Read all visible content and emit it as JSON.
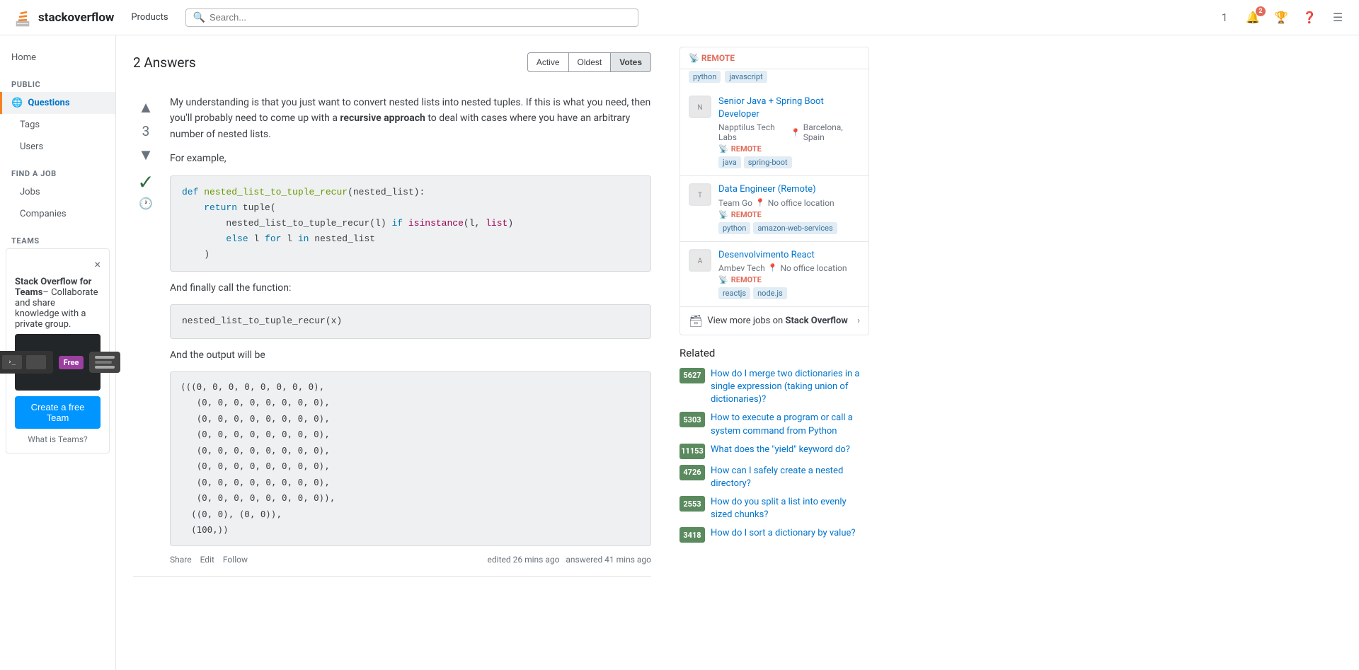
{
  "header": {
    "logo_text_part1": "stack",
    "logo_text_part2": "overflow",
    "nav_products": "Products",
    "search_placeholder": "Search...",
    "notif_count": "2",
    "inbox_count": "1"
  },
  "sidebar": {
    "home": "Home",
    "public_label": "PUBLIC",
    "questions": "Questions",
    "tags": "Tags",
    "users": "Users",
    "find_a_job": "FIND A JOB",
    "jobs": "Jobs",
    "companies": "Companies",
    "teams_label": "TEAMS"
  },
  "answers": {
    "title": "2 Answers",
    "sort_buttons": [
      "Active",
      "Oldest",
      "Votes"
    ],
    "active_sort": "Votes",
    "answer1": {
      "vote_count": "3",
      "accepted": true,
      "body_text": "My understanding is that you just want to convert nested lists into nested tuples. If this is what you need, then you'll probably need to come up with a ",
      "body_bold": "recursive approach",
      "body_text2": " to deal with cases where you have an arbitrary number of nested lists.",
      "example_label": "For example,",
      "code": "def nested_list_to_tuple_recur(nested_list):\n    return tuple(\n        nested_list_to_tuple_recur(l) if isinstance(l, list)\n        else l for l in nested_list\n    )",
      "finally_label": "And finally call the function:",
      "call_code": "nested_list_to_tuple_recur(x)",
      "output_label": "And the output will be",
      "output_code": "(((0, 0, 0, 0, 0, 0, 0, 0),\n   (0, 0, 0, 0, 0, 0, 0, 0),\n   (0, 0, 0, 0, 0, 0, 0, 0),\n   (0, 0, 0, 0, 0, 0, 0, 0),\n   (0, 0, 0, 0, 0, 0, 0, 0),\n   (0, 0, 0, 0, 0, 0, 0, 0),\n   (0, 0, 0, 0, 0, 0, 0, 0),\n   (0, 0, 0, 0, 0, 0, 0, 0)),\n  ((0, 0), (0, 0)),\n  (100,))",
      "share": "Share",
      "edit": "Edit",
      "follow": "Follow",
      "edited_label": "edited 26 mins ago",
      "answered_label": "answered 41 mins ago"
    }
  },
  "jobs": {
    "job1": {
      "title": "Senior Java + Spring Boot Developer",
      "company": "Napptilus Tech Labs",
      "location": "Barcelona, Spain",
      "remote": "REMOTE",
      "tags": [
        "java",
        "spring-boot"
      ]
    },
    "job2": {
      "title": "Data Engineer (Remote)",
      "company": "Team Go",
      "location": "No office location",
      "remote": "REMOTE",
      "tags": [
        "python",
        "amazon-web-services"
      ]
    },
    "job3": {
      "title": "Desenvolvimento React",
      "company": "Ambev Tech",
      "location": "No office location",
      "remote": "REMOTE",
      "tags": [
        "reactjs",
        "node.js"
      ]
    },
    "view_more": "View more jobs on",
    "stack_overflow": "Stack Overflow",
    "prev_job_tags1": [
      "python",
      "javascript"
    ]
  },
  "related": {
    "title": "Related",
    "items": [
      {
        "score": "5627",
        "text": "How do I merge two dictionaries in a single expression (taking union of dictionaries)?",
        "high": true
      },
      {
        "score": "5303",
        "text": "How to execute a program or call a system command from Python",
        "high": true
      },
      {
        "score": "11153",
        "text": "What does the \"yield\" keyword do?",
        "high": true
      },
      {
        "score": "4726",
        "text": "How can I safely create a nested directory?",
        "high": true
      },
      {
        "score": "2553",
        "text": "How do you split a list into evenly sized chunks?",
        "high": true
      },
      {
        "score": "3418",
        "text": "How do I sort a dictionary by value?",
        "high": true
      }
    ]
  },
  "teams": {
    "title": "Stack Overflow for Teams",
    "section_label": "TEAMS",
    "close_label": "×",
    "desc": "– Collaborate and share knowledge with a private group.",
    "free_label": "Free",
    "create_btn": "Create a free Team",
    "what_is": "What is Teams?"
  }
}
